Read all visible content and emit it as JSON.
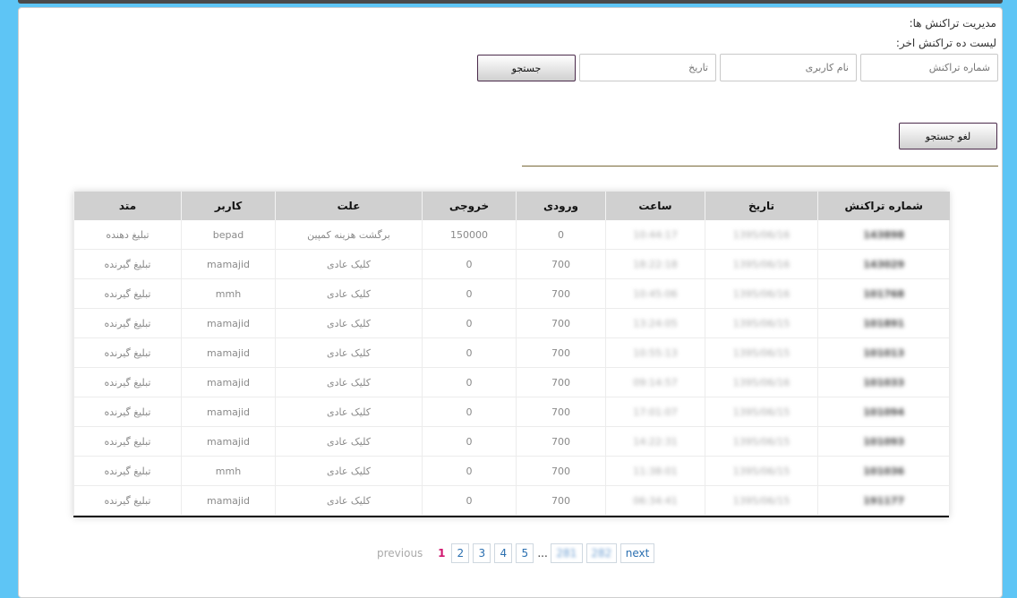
{
  "header": {
    "title": "مدیریت تراکنش ها:",
    "subtitle": "لیست ده تراکنش اخر:"
  },
  "search": {
    "transaction_placeholder": "شماره تراکنش",
    "username_placeholder": "نام کاربری",
    "date_placeholder": "تاریخ",
    "search_label": "جستجو",
    "cancel_label": "لغو جستجو"
  },
  "table": {
    "columns": [
      "شماره تراکنش",
      "تاریخ",
      "ساعت",
      "ورودی",
      "خروجی",
      "علت",
      "کاربر",
      "متد"
    ],
    "rows": [
      {
        "txn": "143898",
        "date": "1395/06/16",
        "time": "10:44:17",
        "in": "0",
        "out": "150000",
        "reason": "برگشت هزینه کمپین",
        "user": "bepad",
        "method": "تبلیغ دهنده"
      },
      {
        "txn": "143029",
        "date": "1395/06/16",
        "time": "18:22:18",
        "in": "700",
        "out": "0",
        "reason": "کلیک عادی",
        "user": "mamajid",
        "method": "تبلیغ گیرنده"
      },
      {
        "txn": "101768",
        "date": "1395/06/16",
        "time": "10:45:06",
        "in": "700",
        "out": "0",
        "reason": "کلیک عادی",
        "user": "mmh",
        "method": "تبلیغ گیرنده"
      },
      {
        "txn": "101891",
        "date": "1395/06/15",
        "time": "13:24:05",
        "in": "700",
        "out": "0",
        "reason": "کلیک عادی",
        "user": "mamajid",
        "method": "تبلیغ گیرنده"
      },
      {
        "txn": "101013",
        "date": "1395/06/15",
        "time": "10:55:13",
        "in": "700",
        "out": "0",
        "reason": "کلیک عادی",
        "user": "mamajid",
        "method": "تبلیغ گیرنده"
      },
      {
        "txn": "101033",
        "date": "1395/06/16",
        "time": "09:14:57",
        "in": "700",
        "out": "0",
        "reason": "کلیک عادی",
        "user": "mamajid",
        "method": "تبلیغ گیرنده"
      },
      {
        "txn": "101094",
        "date": "1395/06/15",
        "time": "17:01:07",
        "in": "700",
        "out": "0",
        "reason": "کلیک عادی",
        "user": "mamajid",
        "method": "تبلیغ گیرنده"
      },
      {
        "txn": "101093",
        "date": "1395/06/15",
        "time": "14:22:31",
        "in": "700",
        "out": "0",
        "reason": "کلیک عادی",
        "user": "mamajid",
        "method": "تبلیغ گیرنده"
      },
      {
        "txn": "101036",
        "date": "1395/06/15",
        "time": "11:38:01",
        "in": "700",
        "out": "0",
        "reason": "کلیک عادی",
        "user": "mmh",
        "method": "تبلیغ گیرنده"
      },
      {
        "txn": "191177",
        "date": "1395/06/15",
        "time": "06:34:41",
        "in": "700",
        "out": "0",
        "reason": "کلیک عادی",
        "user": "mamajid",
        "method": "تبلیغ گیرنده"
      }
    ]
  },
  "pagination": {
    "previous": "previous",
    "current": "1",
    "pages": [
      "2",
      "3",
      "4",
      "5"
    ],
    "dots": "...",
    "last_pages": [
      "281",
      "282"
    ],
    "next": "next"
  }
}
